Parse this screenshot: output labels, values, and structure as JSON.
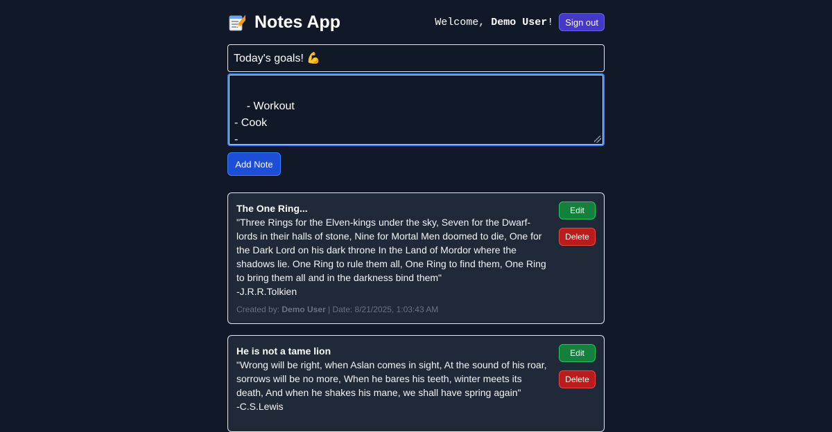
{
  "header": {
    "app_title": "Notes App",
    "app_icon": "notepad-icon",
    "welcome_prefix": "Welcome, ",
    "user_name": "Demo User",
    "welcome_suffix": "!",
    "signout_label": "Sign out"
  },
  "form": {
    "title_value": "Today's goals! 💪",
    "body_value": "- Workout\n- Cook\n-",
    "add_label": "Add Note"
  },
  "notes": [
    {
      "title": "The One Ring...",
      "body": "\"Three Rings for the Elven-kings under the sky, Seven for the Dwarf-lords in their halls of stone, Nine for Mortal Men doomed to die, One for the Dark Lord on his dark throne In the Land of Mordor where the shadows lie. One Ring to rule them all, One Ring to find them, One Ring to bring them all and in the darkness bind them\"\n-J.R.R.Tolkien",
      "created_by_label": "Created by: ",
      "created_by": "Demo User",
      "date_text": " | Date: 8/21/2025, 1:03:43 AM",
      "edit_label": "Edit",
      "delete_label": "Delete"
    },
    {
      "title": "He is not a tame lion",
      "body": "\"Wrong will be right, when Aslan comes in sight, At the sound of his roar, sorrows will be no more, When he bares his teeth, winter meets its death, And when he shakes his mane, we shall have spring again\"\n-C.S.Lewis",
      "edit_label": "Edit",
      "delete_label": "Delete"
    }
  ],
  "colors": {
    "background": "#111827",
    "card": "#1f2937",
    "primary": "#1d4ed8",
    "signout": "#4338ca",
    "edit": "#15803d",
    "delete": "#b91c1c"
  }
}
